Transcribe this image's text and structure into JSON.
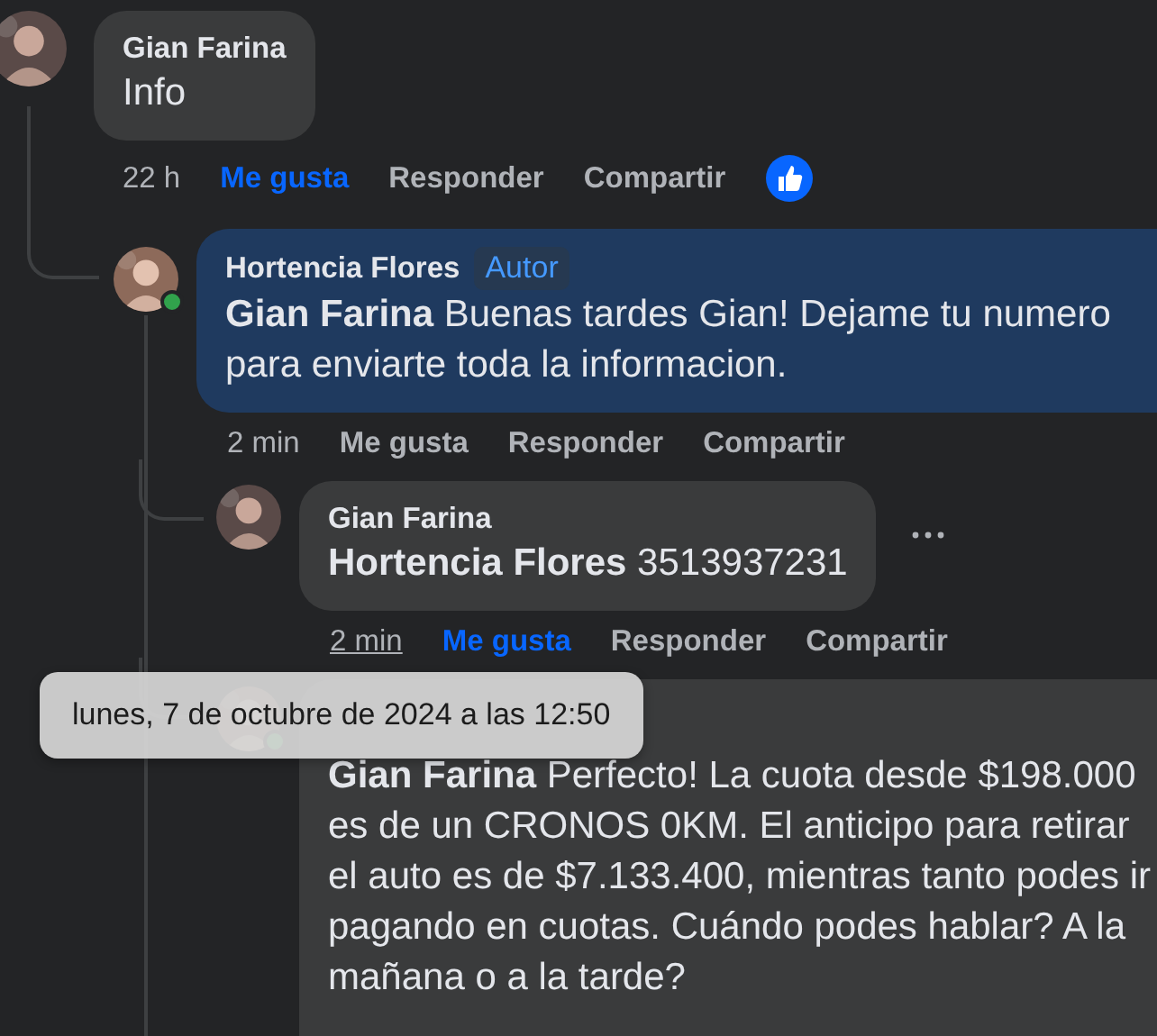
{
  "comments": [
    {
      "author": "Gian Farina",
      "text": "Info",
      "time": "22 h",
      "like": "Me gusta",
      "reply": "Responder",
      "share": "Compartir",
      "liked": true,
      "time_hovered": false,
      "highlighted": false,
      "has_reaction": true,
      "children": [
        {
          "author": "Hortencia Flores",
          "badge": "Autor",
          "text": "**Gian Farina** Buenas tardes Gian! Dejame tu numero para enviarte toda la informacion.",
          "time": "2 min",
          "like": "Me gusta",
          "reply": "Responder",
          "share": "Compartir",
          "liked": false,
          "time_hovered": false,
          "online": true,
          "highlighted": true,
          "children": [
            {
              "author": "Gian Farina",
              "text": "**Hortencia Flores** 3513937231",
              "time": "2 min",
              "like": "Me gusta",
              "reply": "Responder",
              "share": "Compartir",
              "liked": true,
              "time_hovered": true,
              "highlighted": false,
              "menu_visible": true
            },
            {
              "text": "**Gian Farina** Perfecto! La cuota desde $198.000 es de un CRONOS 0KM. El anticipo para retirar el auto es de $7.133.400, mientras tanto podes ir pagando en cuotas. Cuándo podes hablar? A la mañana o a la tarde?",
              "online": true,
              "highlighted": false
            }
          ]
        }
      ]
    }
  ],
  "tooltip": {
    "text": "lunes, 7 de octubre de 2024 a las 12:50"
  }
}
